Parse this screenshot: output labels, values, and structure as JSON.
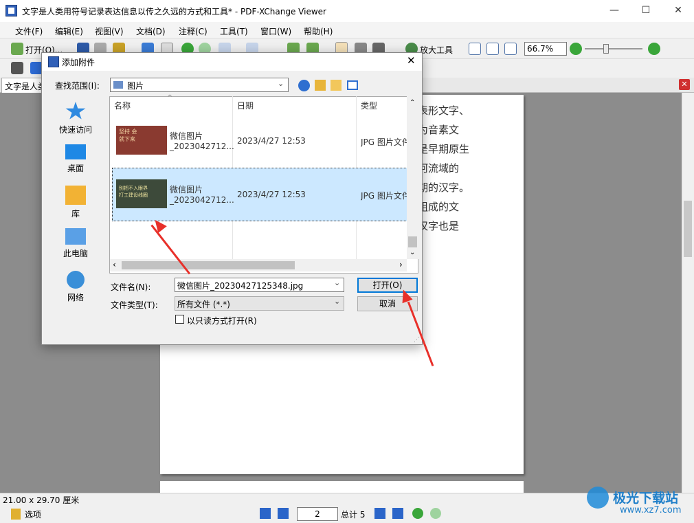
{
  "window": {
    "title": "文字是人类用符号记录表达信息以传之久远的方式和工具* - PDF-XChange Viewer",
    "minimize_glyph": "—",
    "maximize_glyph": "☐",
    "close_glyph": "✕"
  },
  "menu": [
    "文件(F)",
    "编辑(E)",
    "视图(V)",
    "文档(D)",
    "注释(C)",
    "工具(T)",
    "窗口(W)",
    "帮助(H)"
  ],
  "toolbar": {
    "open_label": "打开(O)...",
    "zoom_tool_label": "放大工具",
    "zoom_value": "66.7%"
  },
  "tabs": {
    "doc_tab_label": "文字是人类"
  },
  "document": {
    "visible_lines": [
      "表形文字、",
      "为音素文",
      "是早期原生",
      "河流域的",
      "期的汉字。",
      "组成的文",
      "汉字也是"
    ]
  },
  "status": {
    "page_size": "21.00 x 29.70 厘米"
  },
  "nav": {
    "options_label": "选项",
    "current_page": "2",
    "total_label": "总计 5"
  },
  "dialog": {
    "title": "添加附件",
    "lookin_label": "查找范围(I):",
    "lookin_value": "图片",
    "places": [
      "快速访问",
      "桌面",
      "库",
      "此电脑",
      "网络"
    ],
    "columns": {
      "name": "名称",
      "date": "日期",
      "type": "类型"
    },
    "files": [
      {
        "name_line1": "微信图片",
        "name_line2": "_2023042712...",
        "date": "2023/4/27 12:53",
        "type": "JPG 图片文件",
        "thumb_text": "坚持  会",
        "thumb_text2": "就下来",
        "selected": false
      },
      {
        "name_line1": "微信图片",
        "name_line2": "_2023042712...",
        "date": "2023/4/27 12:53",
        "type": "JPG 图片文件",
        "thumb_text": "别把不入眼界",
        "thumb_text2": "打工建设线圈",
        "selected": true
      }
    ],
    "filename_label": "文件名(N):",
    "filename_value": "微信图片_20230427125348.jpg",
    "filetype_label": "文件类型(T):",
    "filetype_value": "所有文件 (*.*)",
    "readonly_label": "以只读方式打开(R)",
    "open_button": "打开(O)",
    "cancel_button": "取消"
  },
  "watermark": {
    "brand": "极光下载站",
    "url": "www.xz7.com"
  },
  "colors": {
    "accent": "#0078d7",
    "selection": "#cce8ff",
    "arrow": "#e8302a",
    "workspace": "#8c8c8c"
  }
}
